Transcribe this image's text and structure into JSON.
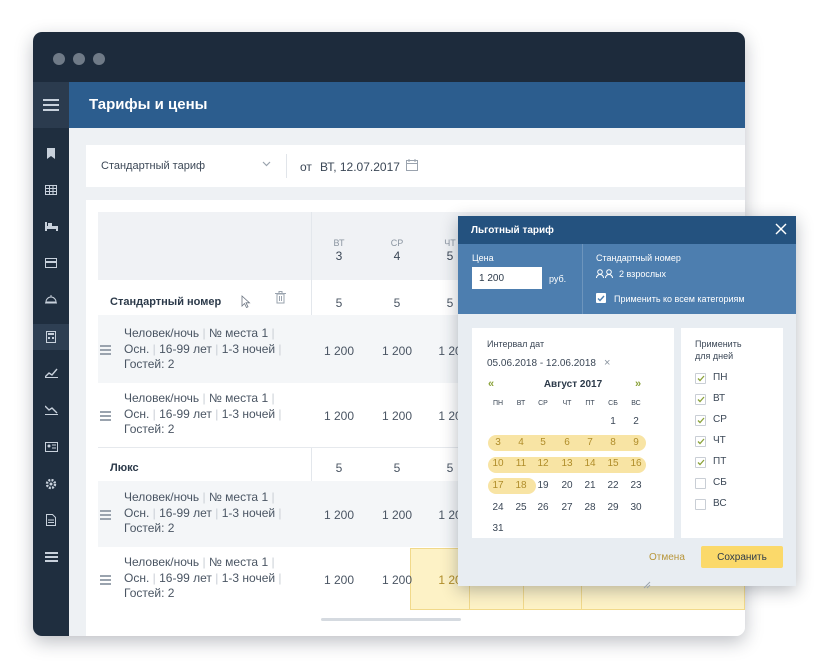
{
  "header": {
    "title": "Тарифы и цены"
  },
  "filter": {
    "tariff": "Стандартный тариф",
    "from_label": "от",
    "date": "ВТ, 12.07.2017"
  },
  "days": [
    {
      "name": "ВТ",
      "date": "3"
    },
    {
      "name": "СР",
      "date": "4"
    },
    {
      "name": "ЧТ",
      "date": "5"
    }
  ],
  "categories": [
    {
      "name": "Стандартный номер",
      "counts": [
        "5",
        "5",
        "5"
      ],
      "rates": [
        {
          "line1": "Человек/ночь",
          "line1b": "№ места 1",
          "line2a": "Осн.",
          "line2b": "16-99 лет",
          "line2c": "1-3 ночей",
          "line3": "Гостей: 2",
          "prices": [
            "1 200",
            "1 200",
            "1 20"
          ]
        },
        {
          "line1": "Человек/ночь",
          "line1b": "№ места 1",
          "line2a": "Осн.",
          "line2b": "16-99 лет",
          "line2c": "1-3 ночей",
          "line3": "Гостей: 2",
          "prices": [
            "1 200",
            "1 200",
            "1 20"
          ]
        }
      ]
    },
    {
      "name": "Люкс",
      "counts": [
        "5",
        "5",
        "5"
      ],
      "rates": [
        {
          "line1": "Человек/ночь",
          "line1b": "№ места 1",
          "line2a": "Осн.",
          "line2b": "16-99 лет",
          "line2c": "1-3 ночей",
          "line3": "Гостей: 2",
          "prices": [
            "1 200",
            "1 200",
            "1 20"
          ]
        },
        {
          "line1": "Человек/ночь",
          "line1b": "№ места 1",
          "line2a": "Осн.",
          "line2b": "16-99 лет",
          "line2c": "1-3 ночей",
          "line3": "Гостей: 2",
          "prices": [
            "1 200",
            "1 200",
            "1 20"
          ]
        }
      ]
    }
  ],
  "popup": {
    "title": "Льготный тариф",
    "price_label": "Цена",
    "price_value": "1 200",
    "currency": "руб.",
    "room_label": "Стандартный номер",
    "guests": "2 взрослых",
    "apply_all": "Применить ко всем категориям",
    "interval_label": "Интервал дат",
    "interval_value": "05.06.2018 - 12.06.2018",
    "prev": "«",
    "next": "»",
    "month": "Август 2017",
    "weekdays": [
      "ПН",
      "ВТ",
      "СР",
      "ЧТ",
      "ПТ",
      "СБ",
      "ВС"
    ],
    "weeks": [
      [
        "",
        "",
        "",
        "",
        "",
        "1",
        "2"
      ],
      [
        "3",
        "4",
        "5",
        "6",
        "7",
        "8",
        "9"
      ],
      [
        "10",
        "11",
        "12",
        "13",
        "14",
        "15",
        "16"
      ],
      [
        "17",
        "18",
        "19",
        "20",
        "21",
        "22",
        "23"
      ],
      [
        "24",
        "25",
        "26",
        "27",
        "28",
        "29",
        "30"
      ],
      [
        "31",
        "",
        "",
        "",
        "",
        "",
        ""
      ]
    ],
    "apply_days_label_1": "Применить",
    "apply_days_label_2": "для дней",
    "apply_days": [
      {
        "label": "ПН",
        "checked": true
      },
      {
        "label": "ВТ",
        "checked": true
      },
      {
        "label": "СР",
        "checked": true
      },
      {
        "label": "ЧТ",
        "checked": true
      },
      {
        "label": "ПТ",
        "checked": true
      },
      {
        "label": "СБ",
        "checked": false
      },
      {
        "label": "ВС",
        "checked": false
      }
    ],
    "cancel": "Отмена",
    "save": "Сохранить"
  }
}
